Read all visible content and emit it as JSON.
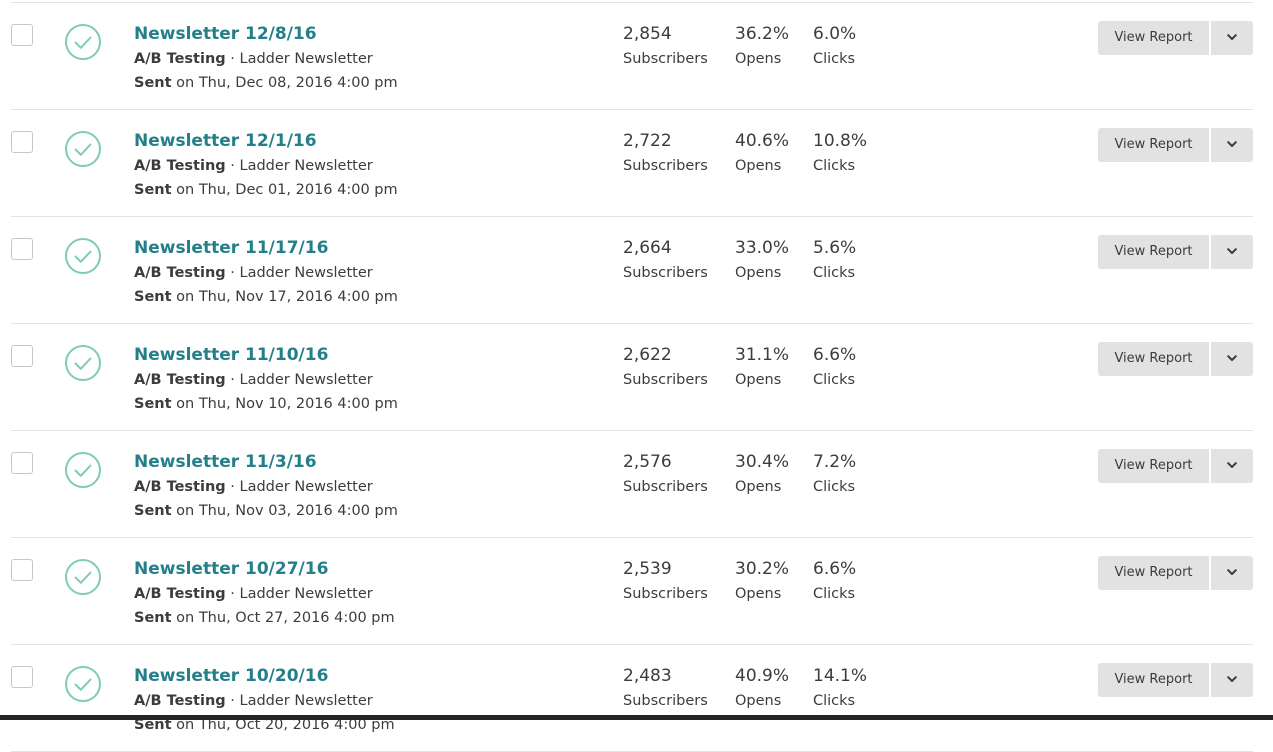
{
  "campaigns": [
    {
      "title": "Newsletter 12/8/16",
      "type": "A/B Testing",
      "list": "Ladder Newsletter",
      "sent_label": "Sent",
      "sent_date": "on Thu, Dec 08, 2016 4:00 pm",
      "subscribers": "2,854",
      "opens": "36.2%",
      "clicks": "6.0%"
    },
    {
      "title": "Newsletter 12/1/16",
      "type": "A/B Testing",
      "list": "Ladder Newsletter",
      "sent_label": "Sent",
      "sent_date": "on Thu, Dec 01, 2016 4:00 pm",
      "subscribers": "2,722",
      "opens": "40.6%",
      "clicks": "10.8%"
    },
    {
      "title": "Newsletter 11/17/16",
      "type": "A/B Testing",
      "list": "Ladder Newsletter",
      "sent_label": "Sent",
      "sent_date": "on Thu, Nov 17, 2016 4:00 pm",
      "subscribers": "2,664",
      "opens": "33.0%",
      "clicks": "5.6%"
    },
    {
      "title": "Newsletter 11/10/16",
      "type": "A/B Testing",
      "list": "Ladder Newsletter",
      "sent_label": "Sent",
      "sent_date": "on Thu, Nov 10, 2016 4:00 pm",
      "subscribers": "2,622",
      "opens": "31.1%",
      "clicks": "6.6%"
    },
    {
      "title": "Newsletter 11/3/16",
      "type": "A/B Testing",
      "list": "Ladder Newsletter",
      "sent_label": "Sent",
      "sent_date": "on Thu, Nov 03, 2016 4:00 pm",
      "subscribers": "2,576",
      "opens": "30.4%",
      "clicks": "7.2%"
    },
    {
      "title": "Newsletter 10/27/16",
      "type": "A/B Testing",
      "list": "Ladder Newsletter",
      "sent_label": "Sent",
      "sent_date": "on Thu, Oct 27, 2016 4:00 pm",
      "subscribers": "2,539",
      "opens": "30.2%",
      "clicks": "6.6%"
    },
    {
      "title": "Newsletter 10/20/16",
      "type": "A/B Testing",
      "list": "Ladder Newsletter",
      "sent_label": "Sent",
      "sent_date": "on Thu, Oct 20, 2016 4:00 pm",
      "subscribers": "2,483",
      "opens": "40.9%",
      "clicks": "14.1%"
    }
  ],
  "labels": {
    "subscribers": "Subscribers",
    "opens": "Opens",
    "clicks": "Clicks",
    "view_report": "View Report",
    "separator": " · "
  },
  "icons": {
    "status": "check-circle-icon",
    "dropdown": "chevron-down-icon"
  },
  "colors": {
    "title_link": "#237f89",
    "status_icon": "#7fcbb8",
    "button_bg": "#e2e2e2"
  }
}
